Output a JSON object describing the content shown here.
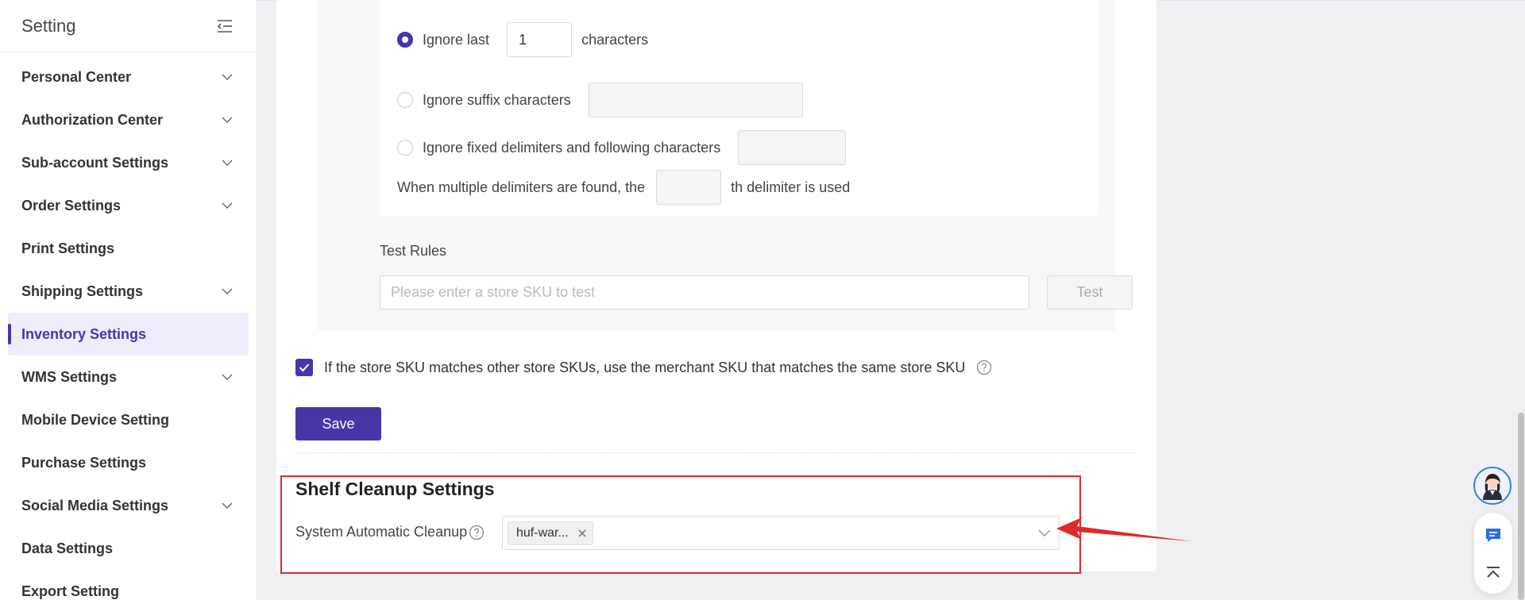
{
  "sidebar": {
    "title": "Setting",
    "items": [
      {
        "label": "Personal Center",
        "has_children": true
      },
      {
        "label": "Authorization Center",
        "has_children": true
      },
      {
        "label": "Sub-account Settings",
        "has_children": true
      },
      {
        "label": "Order Settings",
        "has_children": true
      },
      {
        "label": "Print Settings",
        "has_children": false
      },
      {
        "label": "Shipping Settings",
        "has_children": true
      },
      {
        "label": "Inventory Settings",
        "has_children": false,
        "active": true
      },
      {
        "label": "WMS Settings",
        "has_children": true
      },
      {
        "label": "Mobile Device Setting",
        "has_children": false
      },
      {
        "label": "Purchase Settings",
        "has_children": false
      },
      {
        "label": "Social Media Settings",
        "has_children": true
      },
      {
        "label": "Data Settings",
        "has_children": false
      },
      {
        "label": "Export Setting",
        "has_children": false
      }
    ]
  },
  "rules": {
    "ignore_last": {
      "label": "Ignore last",
      "value": "1",
      "suffix": "characters",
      "selected": true
    },
    "ignore_suffix": {
      "label": "Ignore suffix characters",
      "value": "",
      "selected": false
    },
    "ignore_delimiters": {
      "label": "Ignore fixed delimiters and following characters",
      "value": "",
      "selected": false
    },
    "multiple_delimiters": {
      "prefix": "When multiple delimiters are found, the",
      "value": "",
      "suffix": "th delimiter is used"
    }
  },
  "test": {
    "label": "Test Rules",
    "placeholder": "Please enter a store SKU to test",
    "button": "Test"
  },
  "merchant_sku_option": {
    "label": "If the store SKU matches other store SKUs, use the merchant SKU that matches the same store SKU",
    "checked": true
  },
  "save_label": "Save",
  "shelf_cleanup": {
    "title": "Shelf Cleanup Settings",
    "label": "System Automatic Cleanup",
    "selected_tags": [
      "huf-war..."
    ]
  },
  "colors": {
    "primary": "#4934a8",
    "highlight": "#e02a2a",
    "active_bg": "#efecfc"
  }
}
